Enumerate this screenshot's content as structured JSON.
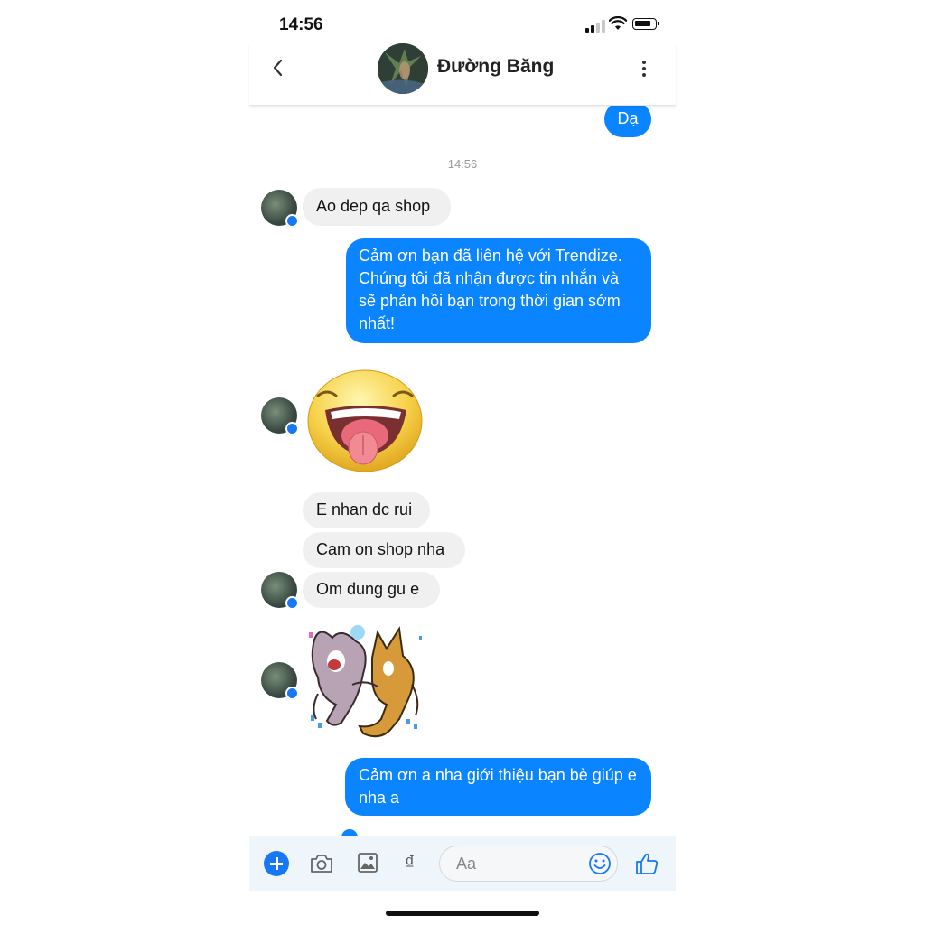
{
  "status_bar": {
    "time": "14:56"
  },
  "header": {
    "contact_name": "Đường Băng"
  },
  "timestamp": "14:56",
  "messages": [
    {
      "from": "me",
      "text": "Dạ"
    },
    {
      "from": "them",
      "text": "Ao dep qa shop"
    },
    {
      "from": "me",
      "text": "Cảm ơn bạn đã liên hệ với Trendize. Chúng tôi đã nhận được tin nhắn và sẽ phản hồi bạn trong thời gian sớm nhất!"
    },
    {
      "from": "them",
      "sticker": "laughing-face-sticker"
    },
    {
      "from": "them",
      "text": "E nhan dc rui"
    },
    {
      "from": "them",
      "text": "Cam on shop nha"
    },
    {
      "from": "them",
      "text": "Om đung gu e"
    },
    {
      "from": "them",
      "sticker": "dancing-cats-sticker"
    },
    {
      "from": "me",
      "text": "Cảm ơn a nha giới thiệu bạn bè giúp e nha a"
    }
  ],
  "composer": {
    "placeholder": "Aa",
    "currency_symbol": "₫"
  },
  "colors": {
    "outgoing_bubble": "#0a84ff",
    "incoming_bubble": "#f0f0f0",
    "accent": "#1877f2"
  }
}
